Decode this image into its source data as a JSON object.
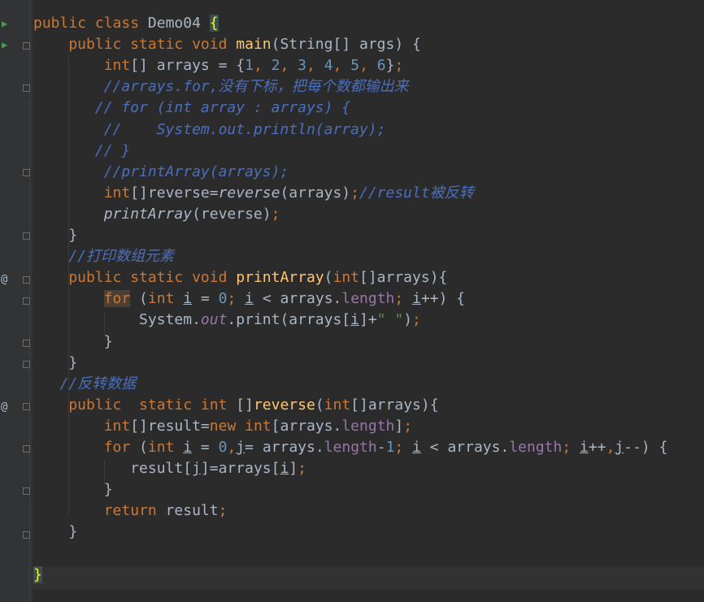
{
  "lines": [
    {
      "id": "l1",
      "segments": [
        {
          "text": "public ",
          "cls": "kw"
        },
        {
          "text": "class ",
          "cls": "kw"
        },
        {
          "text": "Demo04 ",
          "cls": ""
        },
        {
          "text": "{",
          "cls": "brace-hl"
        }
      ]
    },
    {
      "id": "l2",
      "segments": [
        {
          "text": "    public ",
          "cls": "kw"
        },
        {
          "text": "static ",
          "cls": "kw"
        },
        {
          "text": "void ",
          "cls": "kw"
        },
        {
          "text": "main",
          "cls": "fn"
        },
        {
          "text": "(String[] args) {",
          "cls": ""
        }
      ]
    },
    {
      "id": "l3",
      "segments": [
        {
          "text": "        int",
          "cls": "kw"
        },
        {
          "text": "[] arrays = {",
          "cls": ""
        },
        {
          "text": "1",
          "cls": "num"
        },
        {
          "text": ", ",
          "cls": "kw"
        },
        {
          "text": "2",
          "cls": "num"
        },
        {
          "text": ", ",
          "cls": "kw"
        },
        {
          "text": "3",
          "cls": "num"
        },
        {
          "text": ", ",
          "cls": "kw"
        },
        {
          "text": "4",
          "cls": "num"
        },
        {
          "text": ", ",
          "cls": "kw"
        },
        {
          "text": "5",
          "cls": "num"
        },
        {
          "text": ", ",
          "cls": "kw"
        },
        {
          "text": "6",
          "cls": "num"
        },
        {
          "text": "}",
          "cls": ""
        },
        {
          "text": ";",
          "cls": "kw"
        }
      ]
    },
    {
      "id": "l4",
      "segments": [
        {
          "text": "        //arrays.for,没有下标，把每个数都输出来",
          "cls": "blue-cmt"
        }
      ]
    },
    {
      "id": "l5",
      "segments": [
        {
          "text": "       // for (int array : arrays) {",
          "cls": "blue-cmt"
        }
      ]
    },
    {
      "id": "l6",
      "segments": [
        {
          "text": "        //    System.out.println(array);",
          "cls": "blue-cmt"
        }
      ]
    },
    {
      "id": "l7",
      "segments": [
        {
          "text": "       // }",
          "cls": "blue-cmt"
        }
      ]
    },
    {
      "id": "l8",
      "segments": [
        {
          "text": "        //printArray(arrays);",
          "cls": "blue-cmt"
        }
      ]
    },
    {
      "id": "l9",
      "segments": [
        {
          "text": "        int",
          "cls": "kw"
        },
        {
          "text": "[]reverse=",
          "cls": ""
        },
        {
          "text": "reverse",
          "cls": "italic-call"
        },
        {
          "text": "(arrays)",
          "cls": ""
        },
        {
          "text": ";",
          "cls": "kw"
        },
        {
          "text": "//result被反转",
          "cls": "blue-cmt"
        }
      ]
    },
    {
      "id": "l10",
      "segments": [
        {
          "text": "        ",
          "cls": ""
        },
        {
          "text": "printArray",
          "cls": "italic-call"
        },
        {
          "text": "(reverse)",
          "cls": ""
        },
        {
          "text": ";",
          "cls": "kw"
        }
      ]
    },
    {
      "id": "l11",
      "segments": [
        {
          "text": "    }",
          "cls": ""
        }
      ]
    },
    {
      "id": "l12",
      "segments": [
        {
          "text": "    //打印数组元素",
          "cls": "blue-cmt"
        }
      ]
    },
    {
      "id": "l13",
      "segments": [
        {
          "text": "    public ",
          "cls": "kw"
        },
        {
          "text": "static ",
          "cls": "kw"
        },
        {
          "text": "void ",
          "cls": "kw"
        },
        {
          "text": "printArray",
          "cls": "fn"
        },
        {
          "text": "(",
          "cls": ""
        },
        {
          "text": "int",
          "cls": "kw"
        },
        {
          "text": "[]arrays){",
          "cls": ""
        }
      ]
    },
    {
      "id": "l14",
      "segments": [
        {
          "text": "        ",
          "cls": ""
        },
        {
          "text": "for",
          "cls": "kw kw-hl"
        },
        {
          "text": " (",
          "cls": ""
        },
        {
          "text": "int ",
          "cls": "kw"
        },
        {
          "text": "i",
          "cls": "ul"
        },
        {
          "text": " = ",
          "cls": ""
        },
        {
          "text": "0",
          "cls": "num"
        },
        {
          "text": "; ",
          "cls": "kw"
        },
        {
          "text": "i",
          "cls": "ul"
        },
        {
          "text": " < arrays.",
          "cls": ""
        },
        {
          "text": "length",
          "cls": "field"
        },
        {
          "text": "; ",
          "cls": "kw"
        },
        {
          "text": "i",
          "cls": "ul"
        },
        {
          "text": "++) {",
          "cls": ""
        }
      ]
    },
    {
      "id": "l15",
      "segments": [
        {
          "text": "            System.",
          "cls": ""
        },
        {
          "text": "out",
          "cls": "static-field"
        },
        {
          "text": ".print(arrays[",
          "cls": ""
        },
        {
          "text": "i",
          "cls": "ul"
        },
        {
          "text": "]+",
          "cls": ""
        },
        {
          "text": "\" \"",
          "cls": "str"
        },
        {
          "text": ")",
          "cls": ""
        },
        {
          "text": ";",
          "cls": "kw"
        }
      ]
    },
    {
      "id": "l16",
      "segments": [
        {
          "text": "        }",
          "cls": ""
        }
      ]
    },
    {
      "id": "l17",
      "segments": [
        {
          "text": "    }",
          "cls": ""
        }
      ]
    },
    {
      "id": "l18",
      "segments": [
        {
          "text": "   //反转数据",
          "cls": "blue-cmt"
        }
      ]
    },
    {
      "id": "l19",
      "segments": [
        {
          "text": "    public  ",
          "cls": "kw"
        },
        {
          "text": "static ",
          "cls": "kw"
        },
        {
          "text": "int ",
          "cls": "kw"
        },
        {
          "text": "[]",
          "cls": ""
        },
        {
          "text": "reverse",
          "cls": "fn"
        },
        {
          "text": "(",
          "cls": ""
        },
        {
          "text": "int",
          "cls": "kw"
        },
        {
          "text": "[]arrays){",
          "cls": ""
        }
      ]
    },
    {
      "id": "l20",
      "segments": [
        {
          "text": "        int",
          "cls": "kw"
        },
        {
          "text": "[]result=",
          "cls": ""
        },
        {
          "text": "new ",
          "cls": "kw"
        },
        {
          "text": "int",
          "cls": "kw"
        },
        {
          "text": "[arrays.",
          "cls": ""
        },
        {
          "text": "length",
          "cls": "field"
        },
        {
          "text": "]",
          "cls": ""
        },
        {
          "text": ";",
          "cls": "kw"
        }
      ]
    },
    {
      "id": "l21",
      "segments": [
        {
          "text": "        for ",
          "cls": "kw"
        },
        {
          "text": "(",
          "cls": ""
        },
        {
          "text": "int ",
          "cls": "kw"
        },
        {
          "text": "i",
          "cls": "ul"
        },
        {
          "text": " = ",
          "cls": ""
        },
        {
          "text": "0",
          "cls": "num"
        },
        {
          "text": ",",
          "cls": "kw"
        },
        {
          "text": "j",
          "cls": "ul"
        },
        {
          "text": "= arrays.",
          "cls": ""
        },
        {
          "text": "length",
          "cls": "field"
        },
        {
          "text": "-",
          "cls": ""
        },
        {
          "text": "1",
          "cls": "num"
        },
        {
          "text": "; ",
          "cls": "kw"
        },
        {
          "text": "i",
          "cls": "ul"
        },
        {
          "text": " < arrays.",
          "cls": ""
        },
        {
          "text": "length",
          "cls": "field"
        },
        {
          "text": "; ",
          "cls": "kw"
        },
        {
          "text": "i",
          "cls": "ul"
        },
        {
          "text": "++",
          "cls": ""
        },
        {
          "text": ",",
          "cls": "kw"
        },
        {
          "text": "j",
          "cls": "ul"
        },
        {
          "text": "--) {",
          "cls": ""
        }
      ]
    },
    {
      "id": "l22",
      "segments": [
        {
          "text": "           result[",
          "cls": ""
        },
        {
          "text": "j",
          "cls": "ul"
        },
        {
          "text": "]=arrays[",
          "cls": ""
        },
        {
          "text": "i",
          "cls": "ul"
        },
        {
          "text": "]",
          "cls": ""
        },
        {
          "text": ";",
          "cls": "kw"
        }
      ]
    },
    {
      "id": "l23",
      "segments": [
        {
          "text": "        }",
          "cls": ""
        }
      ]
    },
    {
      "id": "l24",
      "segments": [
        {
          "text": "        return ",
          "cls": "kw"
        },
        {
          "text": "result",
          "cls": ""
        },
        {
          "text": ";",
          "cls": "kw"
        }
      ]
    },
    {
      "id": "l25",
      "segments": [
        {
          "text": "    }",
          "cls": ""
        }
      ]
    },
    {
      "id": "l26",
      "segments": [
        {
          "text": "",
          "cls": ""
        }
      ]
    },
    {
      "id": "l27",
      "segments": [
        {
          "text": "}",
          "cls": "brace-hl"
        }
      ]
    }
  ],
  "gutter": {
    "run_icon": "run-arrow-icon",
    "override_icon": "override-at-icon",
    "fold_icon": "fold-icon"
  }
}
